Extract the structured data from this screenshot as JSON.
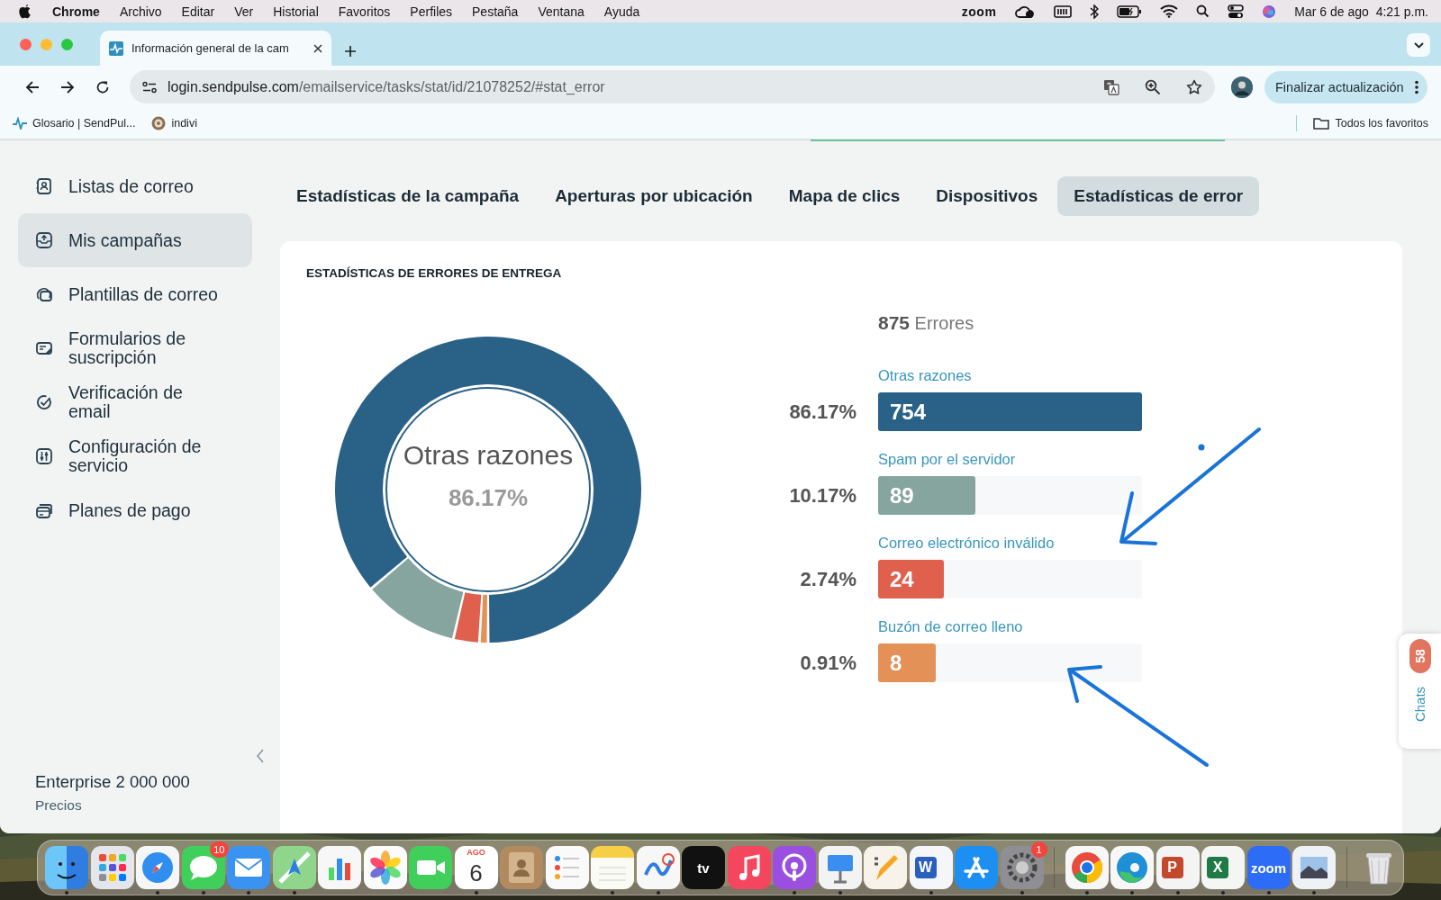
{
  "menu_bar": {
    "app": "Chrome",
    "menus": [
      "Archivo",
      "Editar",
      "Ver",
      "Historial",
      "Favoritos",
      "Perfiles",
      "Pestaña",
      "Ventana",
      "Ayuda"
    ],
    "status_text": "zoom",
    "clock": "Mar 6 de ago  4:21 p.m."
  },
  "browser": {
    "tab_title": "Información general de la cam",
    "url_host": "login.sendpulse.com",
    "url_path": "/emailservice/tasks/stat/id/21078252/#stat_error",
    "update_button": "Finalizar actualización",
    "bookmarks": [
      "Glosario | SendPul...",
      "indivi"
    ],
    "all_bookmarks": "Todos los favoritos"
  },
  "sidebar": {
    "items": [
      {
        "label": "Listas de correo",
        "selected": false
      },
      {
        "label": "Mis campañas",
        "selected": true
      },
      {
        "label": "Plantillas de correo",
        "selected": false
      },
      {
        "label": "Formularios de suscripción",
        "selected": false
      },
      {
        "label": "Verificación de email",
        "selected": false
      },
      {
        "label": "Configuración de servicio",
        "selected": false
      },
      {
        "label": "Planes de pago",
        "selected": false
      }
    ],
    "plan": "Enterprise 2 000 000",
    "plan_link": "Precios"
  },
  "tabs": [
    {
      "label": "Estadísticas de la campaña",
      "selected": false
    },
    {
      "label": "Aperturas por ubicación",
      "selected": false
    },
    {
      "label": "Mapa de clics",
      "selected": false
    },
    {
      "label": "Dispositivos",
      "selected": false
    },
    {
      "label": "Estadísticas de error",
      "selected": true
    }
  ],
  "card": {
    "title": "ESTADÍSTICAS DE ERRORES DE ENTREGA",
    "total_count": "875",
    "total_label": "Errores",
    "chart_data": {
      "type": "donut",
      "categories": [
        "Otras razones",
        "Spam por el servidor",
        "Correo electrónico inválido",
        "Buzón de correo lleno"
      ],
      "values": [
        86.17,
        10.17,
        2.74,
        0.91
      ]
    },
    "center_label": "Otras razones",
    "center_value": "86.17%",
    "legend": [
      {
        "percent": "86.17%",
        "count": "754",
        "color": "#2a6187",
        "level": 1
      },
      {
        "percent": "10.17%",
        "count": "89",
        "color": "#86a59e",
        "level": 0.37
      },
      {
        "percent": "2.74%",
        "count": "24",
        "color": "#e0604e",
        "level": 0.25
      },
      {
        "percent": "0.91%",
        "count": "8",
        "color": "#e39156",
        "level": 0.22
      }
    ]
  },
  "chat_widget": {
    "label": "Chats",
    "badge": "58"
  },
  "dock": {
    "items": [
      {
        "kind": "finder",
        "running": true
      },
      {
        "kind": "launchpad",
        "running": false
      },
      {
        "kind": "safari",
        "running": true
      },
      {
        "kind": "messages",
        "badge": "10",
        "running": true
      },
      {
        "kind": "mail",
        "running": true
      },
      {
        "kind": "maps",
        "running": true
      },
      {
        "kind": "numbers",
        "running": false
      },
      {
        "kind": "photos",
        "running": false
      },
      {
        "kind": "facetime",
        "running": false
      },
      {
        "kind": "calendar",
        "label": "AGO",
        "day": "6",
        "running": true
      },
      {
        "kind": "contacts",
        "running": false
      },
      {
        "kind": "reminders",
        "running": false
      },
      {
        "kind": "notes",
        "running": true
      },
      {
        "kind": "freeform",
        "running": true
      },
      {
        "kind": "tv",
        "label": "tv",
        "running": false
      },
      {
        "kind": "music",
        "running": false
      },
      {
        "kind": "podcasts",
        "running": true
      },
      {
        "kind": "keynote",
        "running": true
      },
      {
        "kind": "pages",
        "running": false
      },
      {
        "kind": "word",
        "label": "W",
        "running": true
      },
      {
        "kind": "appstore",
        "running": false
      },
      {
        "kind": "settings",
        "badge": "1",
        "running": true
      },
      {
        "kind": "separator"
      },
      {
        "kind": "chrome",
        "running": true
      },
      {
        "kind": "edge",
        "running": true
      },
      {
        "kind": "powerpoint",
        "label": "P",
        "running": true
      },
      {
        "kind": "excel",
        "label": "X",
        "running": true
      },
      {
        "kind": "zoom",
        "label": "zoom",
        "running": true
      },
      {
        "kind": "preview",
        "running": true
      },
      {
        "kind": "separator"
      },
      {
        "kind": "trash",
        "running": false
      }
    ]
  }
}
